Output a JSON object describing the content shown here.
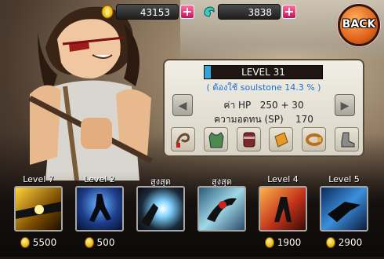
{
  "currency": {
    "gold": {
      "value": "43153",
      "icon": "gold-coin-icon"
    },
    "soulstone": {
      "value": "3838",
      "icon": "soulstone-icon"
    },
    "add_label": "+"
  },
  "back_label": "BACK",
  "panel": {
    "level": "LEVEL 31",
    "soulstone_needed": "( ต้องใช้ soulstone    14.3 % )",
    "progress_fraction": 0.05,
    "hp_label": "ค่า HP",
    "hp_value": "250 + 30",
    "sp_label": "ความอดทน (SP)",
    "sp_value": "170",
    "prev_arrow": "◀",
    "next_arrow": "▶",
    "items": [
      "whip-icon",
      "vest-icon",
      "boots-icon",
      "scroll-icon",
      "belt-icon",
      "shoe-icon"
    ]
  },
  "skills": [
    {
      "label": "Level 7",
      "price": "5500"
    },
    {
      "label": "Level 2",
      "price": "500"
    },
    {
      "label": "สูงสุด",
      "price": ""
    },
    {
      "label": "สูงสุด",
      "price": ""
    },
    {
      "label": "Level 4",
      "price": "1900"
    },
    {
      "label": "Level 5",
      "price": "2900"
    }
  ],
  "colors": {
    "accent": "#e0631a",
    "progress": "#2ea6d9",
    "soul_text": "#1a6fd1",
    "plus": "#c8105a"
  }
}
